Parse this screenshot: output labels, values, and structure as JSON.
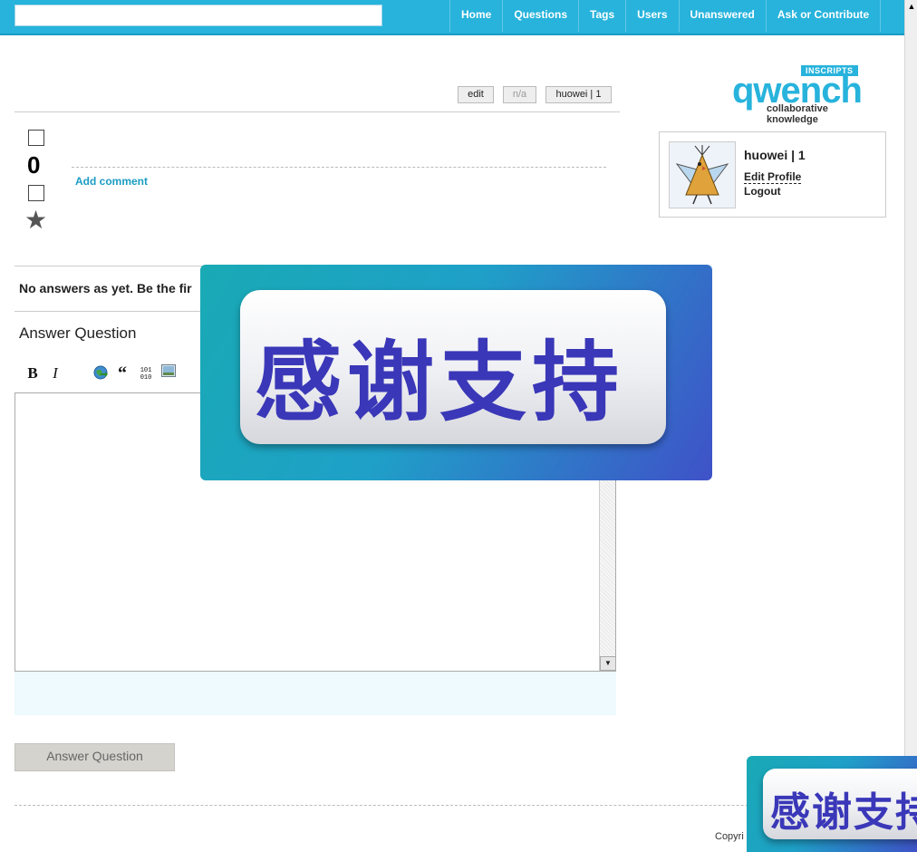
{
  "header": {
    "search_placeholder": "",
    "nav": [
      "Home",
      "Questions",
      "Tags",
      "Users",
      "Unanswered",
      "Ask or Contribute"
    ]
  },
  "logo": {
    "badge": "INSCRIPTS",
    "word": "qwench",
    "tagline": "collaborative knowledge"
  },
  "question_actions": {
    "edit": "edit",
    "na": "n/a",
    "user": "huowei | 1"
  },
  "vote": {
    "count": "0"
  },
  "comment": {
    "add": "Add comment"
  },
  "user_card": {
    "name": "huowei | 1",
    "edit_profile": "Edit Profile",
    "logout": "Logout"
  },
  "answers": {
    "none_text": "No answers as yet. Be the fir",
    "heading": "Answer Question",
    "submit_label": "Answer Question"
  },
  "editor": {
    "bold": "B",
    "italic": "I",
    "quote": "“",
    "code": "101\n010",
    "icons": [
      "bold-icon",
      "italic-icon",
      "link-icon",
      "quote-icon",
      "code-icon",
      "image-icon"
    ]
  },
  "footer": {
    "copyright": "Copyri"
  },
  "overlay": {
    "text": "感谢支持"
  },
  "colors": {
    "accent": "#27b3dc",
    "link": "#1a9cc3",
    "overlay_text": "#3a37b8"
  }
}
